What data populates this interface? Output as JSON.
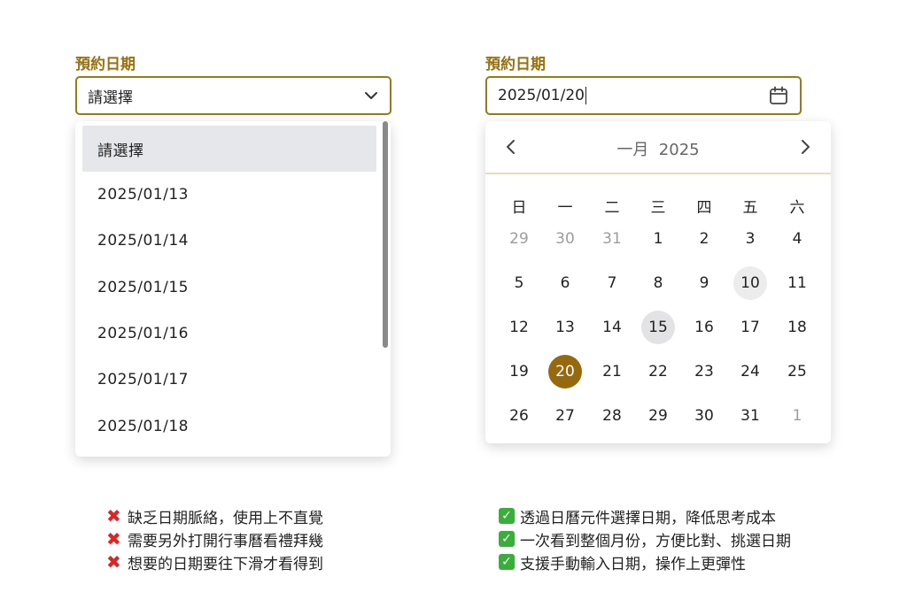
{
  "left": {
    "label": "預約日期",
    "select_value": "請選擇",
    "options": [
      "請選擇",
      "2025/01/13",
      "2025/01/14",
      "2025/01/15",
      "2025/01/16",
      "2025/01/17",
      "2025/01/18"
    ],
    "cons": [
      "缺乏日期脈絡，使用上不直覺",
      "需要另外打開行事曆看禮拜幾",
      "想要的日期要往下滑才看得到"
    ]
  },
  "right": {
    "label": "預約日期",
    "input_value": "2025/01/20",
    "calendar": {
      "month_label": "一月  2025",
      "weekdays": [
        "日",
        "一",
        "二",
        "三",
        "四",
        "五",
        "六"
      ],
      "weeks": [
        [
          "29",
          "30",
          "31",
          "1",
          "2",
          "3",
          "4"
        ],
        [
          "5",
          "6",
          "7",
          "8",
          "9",
          "10",
          "11"
        ],
        [
          "12",
          "13",
          "14",
          "15",
          "16",
          "17",
          "18"
        ],
        [
          "19",
          "20",
          "21",
          "22",
          "23",
          "24",
          "25"
        ],
        [
          "26",
          "27",
          "28",
          "29",
          "30",
          "31",
          "1"
        ]
      ]
    },
    "pros": [
      "透過日曆元件選擇日期，降低思考成本",
      "一次看到整個月份，方便比對、挑選日期",
      "支援手動輸入日期，操作上更彈性"
    ]
  },
  "colors": {
    "accent": "#96690f",
    "border": "#9a7a12",
    "con_icon": "#e02424",
    "pro_icon": "#3aae3a"
  },
  "icons": {
    "select_trailing": "chevron-down-icon",
    "input_trailing": "calendar-icon",
    "cons": "cross-mark-icon",
    "pros": "check-box-icon"
  }
}
